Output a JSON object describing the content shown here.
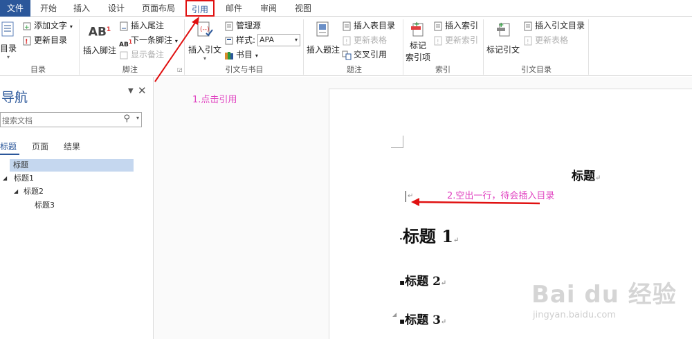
{
  "tabs": [
    "文件",
    "开始",
    "插入",
    "设计",
    "页面布局",
    "引用",
    "邮件",
    "审阅",
    "视图"
  ],
  "groups": {
    "toc": {
      "label": "目录",
      "toc_button": "目录",
      "add_text": "添加文字",
      "update_toc": "更新目录"
    },
    "footnote": {
      "label": "脚注",
      "insert_footnote": "插入脚注",
      "insert_endnote": "插入尾注",
      "next_footnote": "下一条脚注",
      "show_notes": "显示备注"
    },
    "citation": {
      "label": "引文与书目",
      "insert_citation": "插入引文",
      "manage_sources": "管理源",
      "style_label": "样式:",
      "style_value": "APA",
      "bibliography": "书目"
    },
    "caption": {
      "label": "题注",
      "insert_caption": "插入题注",
      "insert_table_of_figures": "插入表目录",
      "update_table": "更新表格",
      "cross_reference": "交叉引用"
    },
    "index": {
      "label": "索引",
      "mark_entry_line1": "标记",
      "mark_entry_line2": "索引项",
      "insert_index": "插入索引",
      "update_index": "更新索引"
    },
    "authorities": {
      "label": "引文目录",
      "mark_citation": "标记引文",
      "insert_toa": "插入引文目录",
      "update_table": "更新表格"
    }
  },
  "nav": {
    "title": "导航",
    "search_placeholder": "搜索文档",
    "tabs": [
      "标题",
      "页面",
      "结果"
    ],
    "tree": [
      "标题",
      "标题1",
      "标题2",
      "标题3"
    ]
  },
  "annotations": {
    "step1": "1.点击引用",
    "step2": "2.空出一行，待会插入目录"
  },
  "doc": {
    "title": "标题",
    "h1_text": "标题",
    "h1_num": "1",
    "h2_text": "标题",
    "h2_num": "2",
    "h3_text": "标题",
    "h3_num": "3",
    "pilcrow": "↵"
  },
  "watermark": {
    "brand": "Bai du 经验",
    "url": "jingyan.baidu.com"
  },
  "colors": {
    "file_tab": "#2b579a",
    "annotation": "#e040c0",
    "arrow": "#e01010",
    "nav_selected": "#c5d7ef"
  }
}
